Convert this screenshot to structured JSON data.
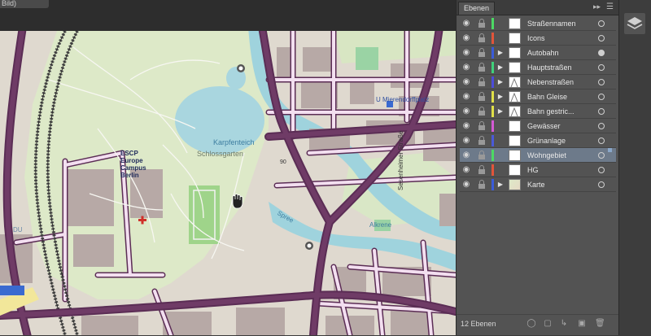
{
  "document": {
    "tab_title": "Bild)"
  },
  "map": {
    "labels": [
      {
        "name": "park-name-label",
        "text": "Schlossgarten"
      },
      {
        "name": "lake-name-label",
        "text": "Karpfenteich"
      },
      {
        "name": "school-name-label",
        "text": "ESCP Europe Campus Berlin"
      },
      {
        "name": "river-name-label",
        "text": "Spree"
      },
      {
        "name": "station-name-label",
        "text": "U Mierendorffplatz"
      },
      {
        "name": "street-name-label",
        "text": "Sesenheimer Straße"
      },
      {
        "name": "district-label",
        "text": "Alkrene"
      },
      {
        "name": "route-label",
        "text": "DU"
      },
      {
        "name": "house-number-label",
        "text": "90"
      }
    ]
  },
  "layers_panel": {
    "tab_label": "Ebenen",
    "collapse_icon": "double-chevron-right-icon",
    "menu_icon": "panel-menu-icon",
    "layers": [
      {
        "name": "Straßennamen",
        "color": "#4cd964",
        "expandable": false,
        "thumb": "blank",
        "target_filled": false,
        "selected": false
      },
      {
        "name": "Icons",
        "color": "#e2553a",
        "expandable": false,
        "thumb": "blank",
        "target_filled": false,
        "selected": false
      },
      {
        "name": "Autobahn",
        "color": "#3a5bd9",
        "expandable": true,
        "thumb": "blank",
        "target_filled": true,
        "selected": false
      },
      {
        "name": "Hauptstraßen",
        "color": "#3fd17a",
        "expandable": true,
        "thumb": "blank",
        "target_filled": false,
        "selected": false
      },
      {
        "name": "Nebenstraßen",
        "color": "#4c4cd9",
        "expandable": true,
        "thumb": "lines",
        "target_filled": false,
        "selected": false
      },
      {
        "name": "Bahn Gleise",
        "color": "#e0e048",
        "expandable": true,
        "thumb": "lines",
        "target_filled": false,
        "selected": false
      },
      {
        "name": "Bahn gestric...",
        "color": "#e0e048",
        "expandable": true,
        "thumb": "lines",
        "target_filled": false,
        "selected": false
      },
      {
        "name": "Gewässer",
        "color": "#d45ad4",
        "expandable": false,
        "thumb": "blank",
        "target_filled": false,
        "selected": false
      },
      {
        "name": "Grünanlage",
        "color": "#4a5ad9",
        "expandable": false,
        "thumb": "blank",
        "target_filled": false,
        "selected": false
      },
      {
        "name": "Wohngebiet",
        "color": "#4cd964",
        "expandable": false,
        "thumb": "blank",
        "target_filled": false,
        "selected": true
      },
      {
        "name": "HG",
        "color": "#e2553a",
        "expandable": false,
        "thumb": "blank",
        "target_filled": false,
        "selected": false
      },
      {
        "name": "Karte",
        "color": "#3a5bd9",
        "expandable": true,
        "thumb": "map",
        "target_filled": false,
        "selected": false
      }
    ],
    "footer": {
      "count_text": "12 Ebenen",
      "buttons": [
        "locate-object-icon",
        "make-clipping-mask-icon",
        "new-sublayer-icon",
        "new-layer-icon",
        "delete-layer-icon"
      ]
    }
  },
  "dock": {
    "icon": "layers-icon"
  },
  "colors": {
    "road_fill": "#f3dff0",
    "road_outline": "#5b2d55",
    "water": "#9fd3dd",
    "park": "#dde9c8",
    "building": "#b7a9a6",
    "panel_bg": "#535353"
  }
}
